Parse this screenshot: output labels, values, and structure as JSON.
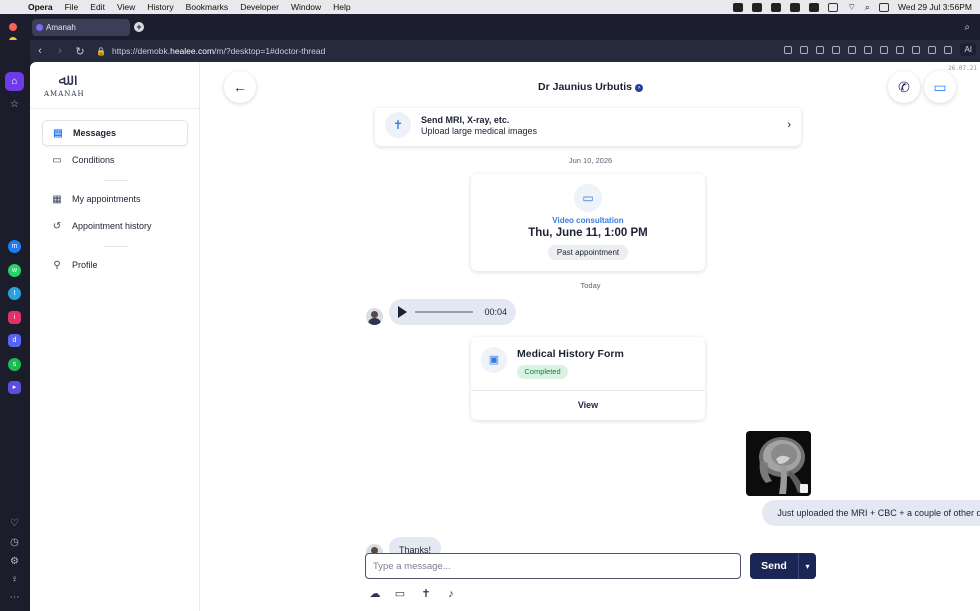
{
  "menubar": {
    "app": "Opera",
    "items": [
      "File",
      "Edit",
      "View",
      "History",
      "Bookmarks",
      "Developer",
      "Window",
      "Help"
    ],
    "datetime": "Wed 29 Jul  3:56PM"
  },
  "browser": {
    "tab_title": "Amanah",
    "url_prefix": "https://demobk.",
    "url_domain": "healee.com",
    "url_suffix": "/m/?desktop=1#doctor-thread",
    "ai_label": "AI",
    "version": "26.07.21"
  },
  "brand": {
    "name": "AMANAH"
  },
  "nav": {
    "items": [
      {
        "label": "Messages",
        "icon": "chat-icon"
      },
      {
        "label": "Conditions",
        "icon": "folder-icon"
      },
      {
        "label": "My appointments",
        "icon": "calendar-icon"
      },
      {
        "label": "Appointment history",
        "icon": "history-icon"
      },
      {
        "label": "Profile",
        "icon": "person-icon"
      }
    ]
  },
  "thread": {
    "doctor_name": "Dr Jaunius Urbutis",
    "upload_card": {
      "title": "Send MRI, X-ray, etc.",
      "subtitle": "Upload large medical images"
    },
    "date_1": "Jun 10, 2026",
    "video_card": {
      "label": "Video consultation",
      "datetime": "Thu, June 11, 1:00 PM",
      "status": "Past appointment"
    },
    "date_2": "Today",
    "voice_message": {
      "duration": "00:04",
      "progress": 0
    },
    "form_card": {
      "title": "Medical History Form",
      "status": "Completed",
      "action": "View"
    },
    "outgoing_message": "Just uploaded the MRI + CBC + a couple of other docs",
    "incoming_message": "Thanks!"
  },
  "composer": {
    "placeholder": "Type a message...",
    "send_label": "Send"
  },
  "colors": {
    "accent": "#2f7df6",
    "primary_dark": "#1c2654",
    "bubble": "#e4e8f3",
    "completed_bg": "#d8f3e3",
    "completed_text": "#17803f"
  }
}
